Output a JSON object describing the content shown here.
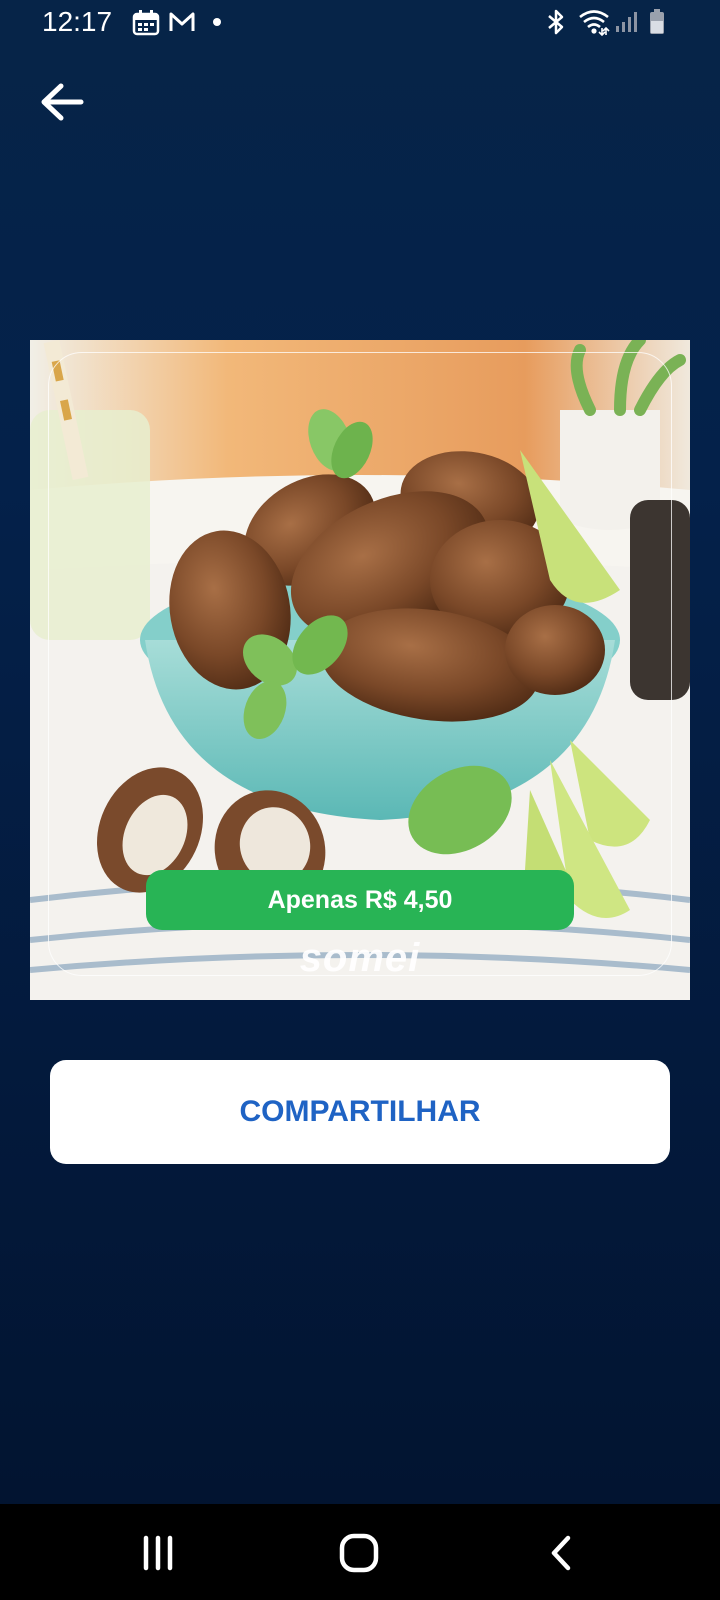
{
  "status_bar": {
    "time": "12:17",
    "left_icons": [
      "calendar-icon",
      "gmail-icon",
      "notification-dot-icon"
    ],
    "right_icons": [
      "bluetooth-icon",
      "wifi-icon",
      "signal-icon",
      "battery-icon"
    ]
  },
  "header": {
    "back_icon": "arrow-left-icon"
  },
  "promo": {
    "price_label": "Apenas R$ 4,50",
    "brand_logo": "somei",
    "badge_color": "#28b455"
  },
  "actions": {
    "share_label": "COMPARTILHAR",
    "share_color": "#1f63c4"
  },
  "nav_bar": {
    "icons": [
      "recent-apps-icon",
      "home-icon",
      "back-icon"
    ]
  },
  "colors": {
    "background": "#04214a"
  }
}
